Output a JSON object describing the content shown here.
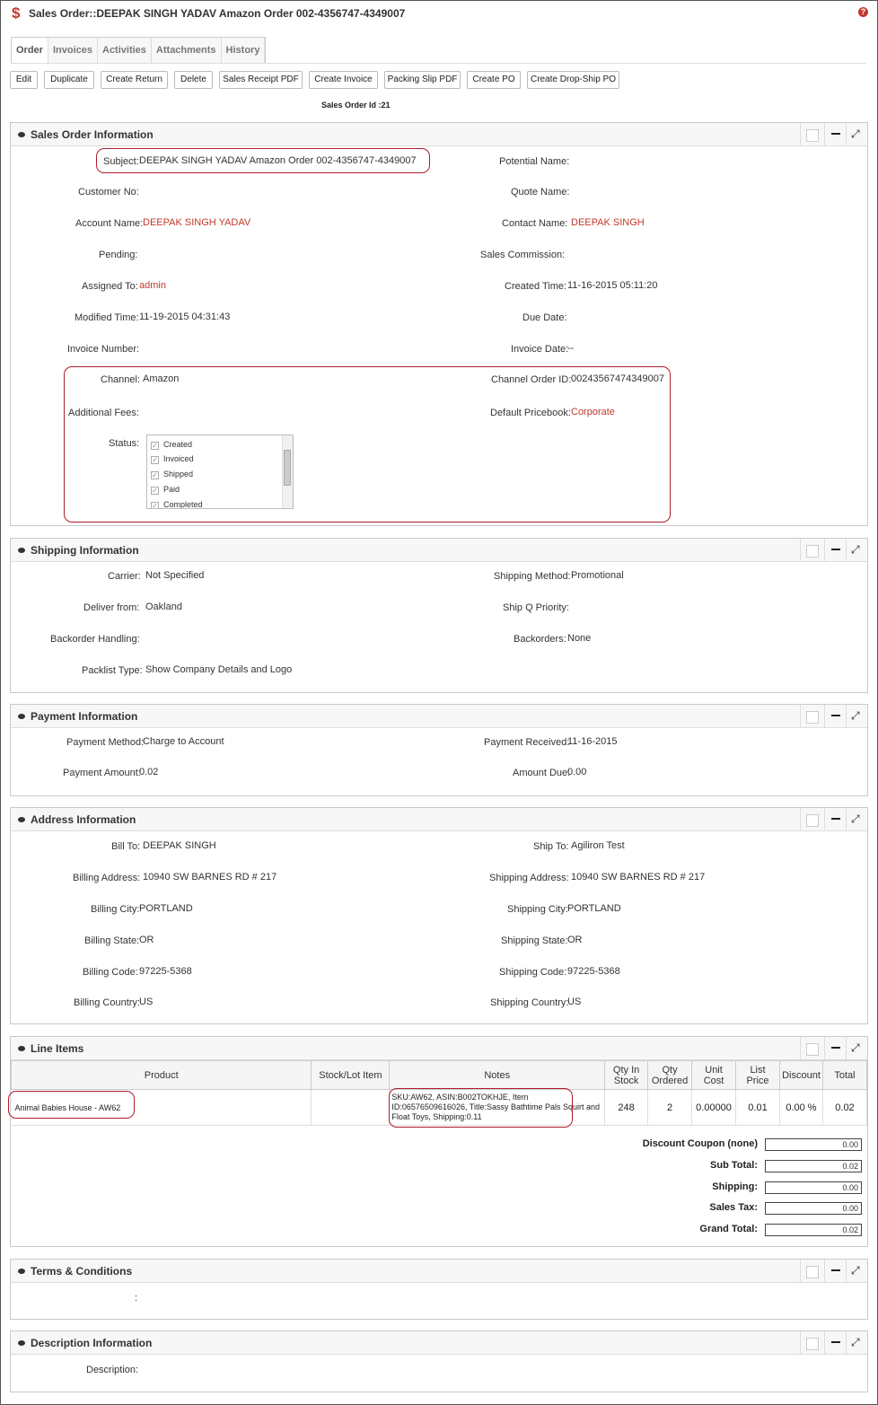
{
  "header": {
    "title": "Sales Order::DEEPAK SINGH YADAV Amazon Order 002-4356747-4349007",
    "help": "?"
  },
  "tabs": [
    {
      "label": "Order"
    },
    {
      "label": "Invoices"
    },
    {
      "label": "Activities"
    },
    {
      "label": "Attachments"
    },
    {
      "label": "History"
    }
  ],
  "toolbar": {
    "edit": "Edit",
    "duplicate": "Duplicate",
    "create_return": "Create Return",
    "delete": "Delete",
    "sales_receipt_pdf": "Sales Receipt PDF",
    "create_invoice": "Create Invoice",
    "packing_slip_pdf": "Packing Slip PDF",
    "create_po": "Create PO",
    "create_drop_ship_po": "Create Drop-Ship PO"
  },
  "sales_order_id": "Sales Order Id :21",
  "sales_order_info": {
    "title": "Sales Order Information",
    "subject_label": "Subject:",
    "subject": "DEEPAK SINGH YADAV Amazon Order 002-4356747-4349007",
    "potential_name_label": "Potential Name:",
    "customer_no_label": "Customer No:",
    "quote_name_label": "Quote Name:",
    "account_name_label": "Account Name:",
    "account_name": "DEEPAK SINGH YADAV",
    "contact_name_label": "Contact Name:",
    "contact_name": "DEEPAK SINGH",
    "pending_label": "Pending:",
    "sales_commission_label": "Sales Commission:",
    "assigned_to_label": "Assigned To:",
    "assigned_to": "admin",
    "created_time_label": "Created Time:",
    "created_time": "11-16-2015 05:11:20",
    "modified_time_label": "Modified Time:",
    "modified_time": "11-19-2015 04:31:43",
    "due_date_label": "Due Date:",
    "invoice_number_label": "Invoice Number:",
    "invoice_date_label": "Invoice Date:",
    "invoice_date": "--",
    "channel_label": "Channel:",
    "channel": "Amazon",
    "channel_order_id_label": "Channel Order ID:",
    "channel_order_id": "00243567474349007",
    "additional_fees_label": "Additional Fees:",
    "default_pricebook_label": "Default Pricebook:",
    "default_pricebook": "Corporate",
    "status_label": "Status:",
    "status_options": [
      {
        "label": "Created",
        "checked": true
      },
      {
        "label": "Invoiced",
        "checked": true
      },
      {
        "label": "Shipped",
        "checked": true
      },
      {
        "label": "Paid",
        "checked": true
      },
      {
        "label": "Completed",
        "checked": true
      }
    ]
  },
  "shipping_info": {
    "title": "Shipping Information",
    "carrier_label": "Carrier:",
    "carrier": "Not Specified",
    "shipping_method_label": "Shipping Method:",
    "shipping_method": "Promotional",
    "deliver_from_label": "Deliver from:",
    "deliver_from": "Oakland",
    "ship_q_priority_label": "Ship Q Priority:",
    "backorder_handling_label": "Backorder Handling:",
    "backorders_label": "Backorders:",
    "backorders": "None",
    "packlist_type_label": "Packlist Type:",
    "packlist_type": "Show Company Details and Logo"
  },
  "payment_info": {
    "title": "Payment Information",
    "payment_method_label": "Payment Method:",
    "payment_method": "Charge to Account",
    "payment_received_label": "Payment Received:",
    "payment_received": "11-16-2015",
    "payment_amount_label": "Payment Amount:",
    "payment_amount": "0.02",
    "amount_due_label": "Amount Due:",
    "amount_due": "0.00"
  },
  "address_info": {
    "title": "Address Information",
    "bill_to_label": "Bill To:",
    "bill_to": "DEEPAK SINGH",
    "ship_to_label": "Ship To:",
    "ship_to": "Agiliron Test",
    "billing_address_label": "Billing Address:",
    "billing_address": "10940 SW BARNES RD # 217",
    "shipping_address_label": "Shipping Address:",
    "shipping_address": "10940 SW BARNES RD # 217",
    "billing_city_label": "Billing City:",
    "billing_city": "PORTLAND",
    "shipping_city_label": "Shipping City:",
    "shipping_city": "PORTLAND",
    "billing_state_label": "Billing State:",
    "billing_state": "OR",
    "shipping_state_label": "Shipping State:",
    "shipping_state": "OR",
    "billing_code_label": "Billing Code:",
    "billing_code": "97225-5368",
    "shipping_code_label": "Shipping Code:",
    "shipping_code": "97225-5368",
    "billing_country_label": "Billing Country:",
    "billing_country": "US",
    "shipping_country_label": "Shipping Country:",
    "shipping_country": "US"
  },
  "line_items": {
    "title": "Line Items",
    "columns": {
      "product": "Product",
      "stock_lot": "Stock/Lot Item",
      "notes": "Notes",
      "qty_in_stock_1": "Qty In",
      "qty_in_stock_2": "Stock",
      "qty_ordered_1": "Qty",
      "qty_ordered_2": "Ordered",
      "unit_cost_1": "Unit",
      "unit_cost_2": "Cost",
      "list_price_1": "List",
      "list_price_2": "Price",
      "discount": "Discount",
      "total": "Total"
    },
    "rows": [
      {
        "product": "Animal Babies House - AW62",
        "stock_lot": "",
        "notes": "SKU:AW62, ASIN:B002TOKHJE, Item ID:06576509616026, Title:Sassy Bathtime Pals Squirt and Float Toys, Shipping:0.11",
        "qty_in_stock": "248",
        "qty_ordered": "2",
        "unit_cost": "0.00000",
        "list_price": "0.01",
        "discount": "0.00 %",
        "total": "0.02"
      }
    ],
    "totals": {
      "discount_coupon_label": "Discount Coupon (none)",
      "discount_coupon": "0.00",
      "sub_total_label": "Sub Total:",
      "sub_total": "0.02",
      "shipping_label": "Shipping:",
      "shipping": "0.00",
      "sales_tax_label": "Sales Tax:",
      "sales_tax": "0.00",
      "grand_total_label": "Grand Total:",
      "grand_total": "0.02"
    }
  },
  "terms": {
    "title": "Terms & Conditions",
    "colon": ":"
  },
  "description": {
    "title": "Description Information",
    "description_label": "Description:"
  },
  "colors": {
    "accent": "#c0392b",
    "highlight": "#b01c2e"
  },
  "icons": {
    "currency": "dollar-icon",
    "help": "help-icon",
    "panel_toggle": "eye-icon",
    "minimize": "minus-icon",
    "expand": "expand-icon"
  }
}
